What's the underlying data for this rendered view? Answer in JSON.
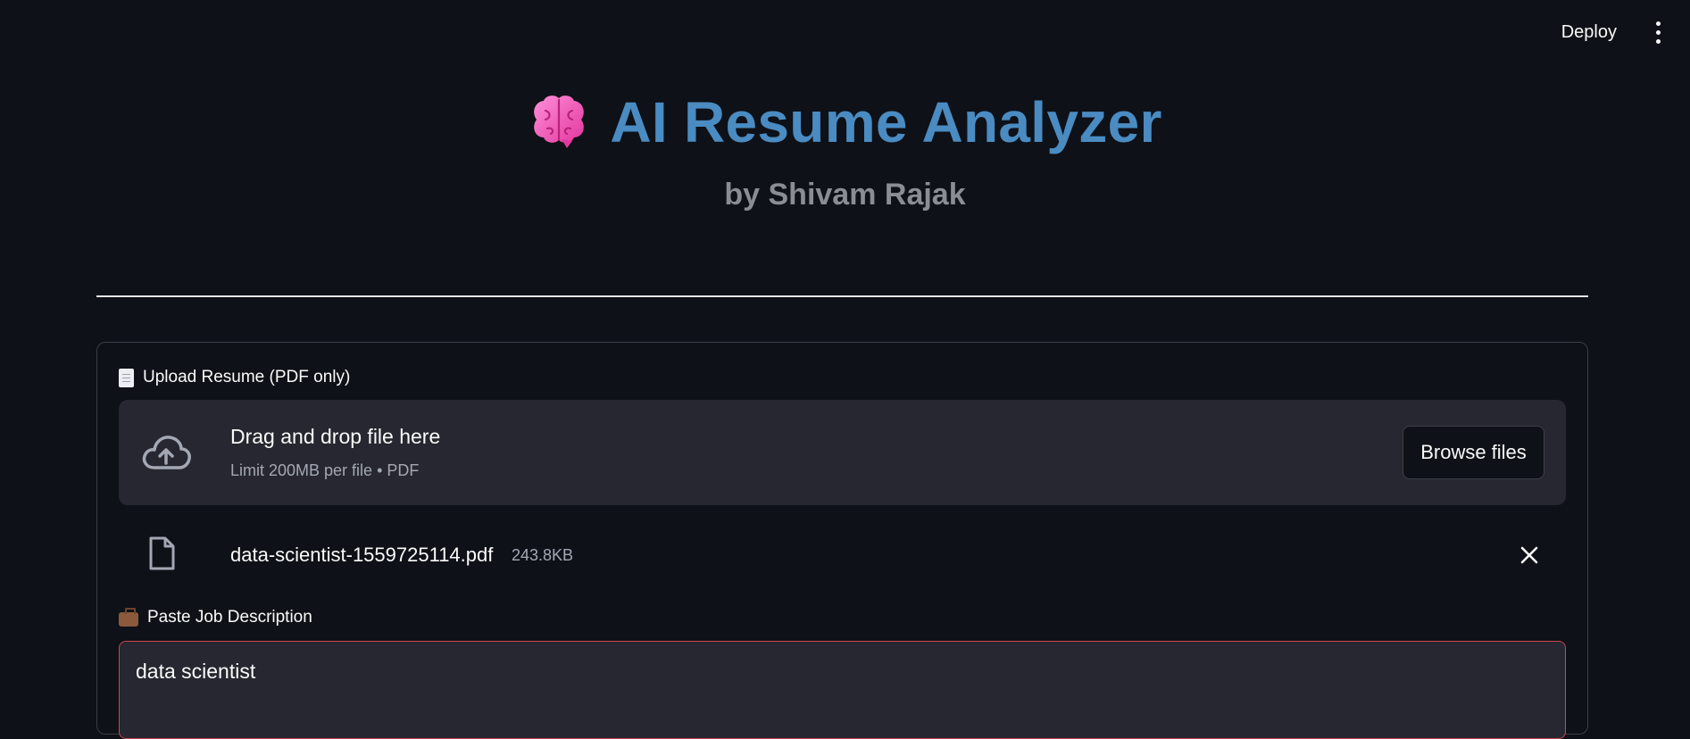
{
  "topbar": {
    "deploy_label": "Deploy",
    "menu_icon": "more-vertical-icon"
  },
  "header": {
    "icon": "brain-icon",
    "title": "AI Resume Analyzer",
    "subtitle": "by Shivam Rajak"
  },
  "upload": {
    "label": "Upload Resume (PDF only)",
    "label_icon": "page-facing-up-icon",
    "dropzone_title": "Drag and drop file here",
    "dropzone_subtitle": "Limit 200MB per file • PDF",
    "browse_label": "Browse files",
    "file": {
      "name": "data-scientist-1559725114.pdf",
      "size": "243.8KB"
    }
  },
  "job": {
    "label": "Paste Job Description",
    "label_icon": "briefcase-icon",
    "value": "data scientist"
  },
  "colors": {
    "background": "#0e1117",
    "title": "#4a8bc2",
    "subtitle": "#8a8d93",
    "panel": "#262730",
    "active_border": "#c9474f"
  }
}
